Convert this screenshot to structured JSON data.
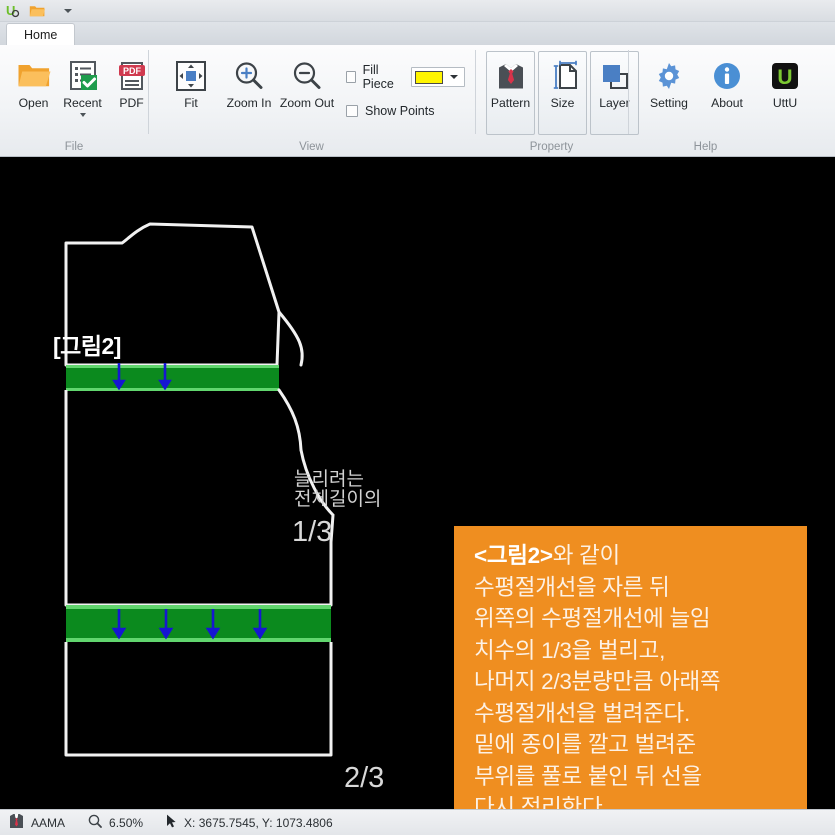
{
  "titlebar": {
    "icons": [
      {
        "name": "uttu-logo-icon"
      },
      {
        "name": "open-folder-icon"
      },
      {
        "name": "customize-quick-access-caret-icon"
      }
    ]
  },
  "tabs": [
    {
      "label": "Home",
      "name": "tab-home",
      "active": true
    }
  ],
  "ribbon": {
    "groups": [
      {
        "title": "File",
        "name": "ribbon-group-file",
        "buttons": [
          {
            "label": "Open",
            "icon": "open-folder-icon",
            "name": "open-button"
          },
          {
            "label": "Recent",
            "icon": "recent-list-icon",
            "name": "recent-button",
            "has_caret": true
          },
          {
            "label": "PDF",
            "icon": "pdf-icon",
            "name": "pdf-button"
          }
        ]
      },
      {
        "title": "View",
        "name": "ribbon-group-view",
        "buttons": [
          {
            "label": "Fit",
            "icon": "fit-icon",
            "name": "fit-button"
          },
          {
            "label": "Zoom In",
            "icon": "zoom-in-icon",
            "name": "zoom-in-button"
          },
          {
            "label": "Zoom Out",
            "icon": "zoom-out-icon",
            "name": "zoom-out-button"
          }
        ],
        "checks": [
          {
            "label": "Fill Piece",
            "checked": false,
            "name": "fill-piece-checkbox",
            "color": "#FFF500"
          },
          {
            "label": "Show Points",
            "checked": false,
            "name": "show-points-checkbox"
          }
        ]
      },
      {
        "title": "Property",
        "name": "ribbon-group-property",
        "buttons": [
          {
            "label": "Pattern",
            "icon": "shirt-tie-icon",
            "name": "pattern-button"
          },
          {
            "label": "Size",
            "icon": "page-measure-icon",
            "name": "size-button"
          },
          {
            "label": "Layer",
            "icon": "layers-icon",
            "name": "layer-button"
          }
        ]
      },
      {
        "title": "Help",
        "name": "ribbon-group-help",
        "buttons": [
          {
            "label": "Setting",
            "icon": "gear-icon",
            "name": "setting-button"
          },
          {
            "label": "About",
            "icon": "info-icon",
            "name": "about-button"
          },
          {
            "label": "UttU",
            "icon": "uttu-badge-icon",
            "name": "uttu-button"
          }
        ]
      }
    ]
  },
  "canvas": {
    "background": "#000000",
    "figure_title": "[그림2]",
    "annotation_text_line1": "늘리려는",
    "annotation_text_line2": "전체길이의",
    "fraction_top": "1/3",
    "fraction_bottom": "2/3",
    "slash_band_color": "#0b8a1e",
    "slash_band_edge_color": "#61d66e",
    "arrow_color": "#1616d2",
    "outline_color": "#ffffff",
    "callout": {
      "background": "#ef8e20",
      "lines": [
        {
          "bold": "<그림2>",
          "rest": "와 같이"
        },
        {
          "bold": "",
          "rest": "수평절개선을 자른 뒤"
        },
        {
          "bold": "",
          "rest": "위쪽의 수평절개선에 늘임"
        },
        {
          "bold": "",
          "rest": "치수의 1/3을 벌리고,"
        },
        {
          "bold": "",
          "rest": "나머지 2/3분량만큼 아래쪽"
        },
        {
          "bold": "",
          "rest": "수평절개선을 벌려준다."
        },
        {
          "bold": "",
          "rest": "밑에 종이를 깔고 벌려준"
        },
        {
          "bold": "",
          "rest": "부위를 풀로 붙인 뒤 선을"
        },
        {
          "bold": "",
          "rest": "다시 정리한다."
        }
      ]
    }
  },
  "statusbar": {
    "format_icon": "garment-icon",
    "format_label": "AAMA",
    "zoom_icon": "magnifier-icon",
    "zoom_value": "6.50%",
    "cursor_icon": "cursor-arrow-icon",
    "coords": "X: 3675.7545, Y: 1073.4806"
  }
}
